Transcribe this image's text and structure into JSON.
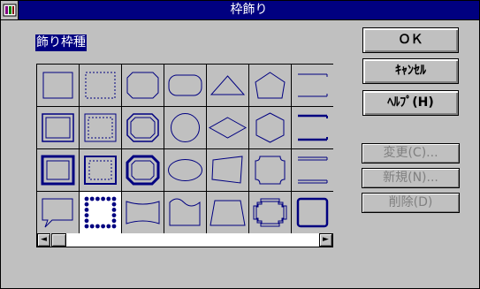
{
  "window": {
    "title": "枠飾り",
    "system_menu_icon": "system-menu-icon"
  },
  "frame_type_label": "飾り枠種",
  "buttons": {
    "ok": "ＯＫ",
    "cancel": "ｷｬﾝｾﾙ",
    "help": "ﾍﾙﾌﾟ(H)",
    "change": "変更(C)...",
    "new": "新規(N)...",
    "delete": "削除(D)"
  },
  "frame_grid": {
    "columns": 7,
    "rows": 4,
    "selected_index": 22,
    "frame_color": "#000080",
    "cells": [
      "rectangle-thin",
      "rectangle-dotted",
      "octagon-rect",
      "rounded-rect",
      "triangle",
      "pentagon",
      "bracket-lines",
      "double-rectangle",
      "double-dotted-rectangle",
      "double-octagon",
      "circle",
      "diamond",
      "hexagon",
      "double-bracket-lines",
      "thick-rectangle",
      "thick-dotted-rectangle",
      "thick-octagon",
      "ellipse",
      "slanted-rectangle",
      "scalloped-rectangle",
      "triple-bracket-lines",
      "speech-balloon",
      "dotted-border",
      "curved-banner",
      "wave-rectangle",
      "trapezoid",
      "cross-octagon",
      "rounded-thick-rectangle"
    ]
  },
  "scrollbar": {
    "left_arrow": "◄",
    "right_arrow": "►"
  }
}
